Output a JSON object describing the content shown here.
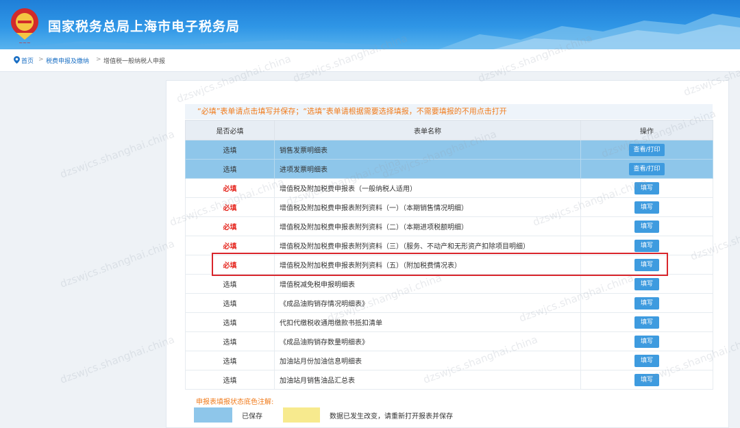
{
  "header": {
    "title": "国家税务总局上海市电子税务局",
    "emblem_icon": "tax-emblem-icon"
  },
  "breadcrumb": {
    "home": "首页",
    "items": [
      "税费申报及缴纳",
      "增值税一般纳税人申报"
    ],
    "separator": ">"
  },
  "notice": "“必填”表单请点击填写并保存；“选填”表单请根据需要选择填报，不需要填报的不用点击打开",
  "table": {
    "headers": [
      "是否必填",
      "表单名称",
      "操作"
    ],
    "rows": [
      {
        "required": "选填",
        "name": "销售发票明细表",
        "action": "查看/打印",
        "saved": true
      },
      {
        "required": "选填",
        "name": "进项发票明细表",
        "action": "查看/打印",
        "saved": true
      },
      {
        "required": "必填",
        "name": "增值税及附加税费申报表（一般纳税人适用）",
        "action": "填写",
        "saved": false
      },
      {
        "required": "必填",
        "name": "增值税及附加税费申报表附列资料（一）（本期销售情况明细）",
        "action": "填写",
        "saved": false
      },
      {
        "required": "必填",
        "name": "增值税及附加税费申报表附列资料（二）（本期进项税额明细）",
        "action": "填写",
        "saved": false
      },
      {
        "required": "必填",
        "name": "增值税及附加税费申报表附列资料（三）（服务、不动产和无形资产扣除项目明细）",
        "action": "填写",
        "saved": false
      },
      {
        "required": "必填",
        "name": "增值税及附加税费申报表附列资料（五）（附加税费情况表）",
        "action": "填写",
        "saved": false
      },
      {
        "required": "选填",
        "name": "增值税减免税申报明细表",
        "action": "填写",
        "saved": false
      },
      {
        "required": "选填",
        "name": "《成品油购销存情况明细表》",
        "action": "填写",
        "saved": false
      },
      {
        "required": "选填",
        "name": "代扣代缴税收通用缴款书抵扣清单",
        "action": "填写",
        "saved": false
      },
      {
        "required": "选填",
        "name": "《成品油购销存数量明细表》",
        "action": "填写",
        "saved": false
      },
      {
        "required": "选填",
        "name": "加油站月份加油信息明细表",
        "action": "填写",
        "saved": false
      },
      {
        "required": "选填",
        "name": "加油站月销售油品汇总表",
        "action": "填写",
        "saved": false
      }
    ]
  },
  "legend": {
    "title": "申报表填报状态底色注解:",
    "saved_label": "已保存",
    "changed_label": "数据已发生改变，请重新打开报表并保存",
    "saved_color": "#8ec6ea",
    "changed_color": "#f7ea8e"
  },
  "watermark": "dzswjcs.shanghai.china",
  "colors": {
    "header_blue": "#2f8fe2",
    "accent_orange": "#f07b1c",
    "required_red": "#e5271f",
    "button_blue": "#3e9bdf",
    "highlight_red": "#d9252b"
  }
}
